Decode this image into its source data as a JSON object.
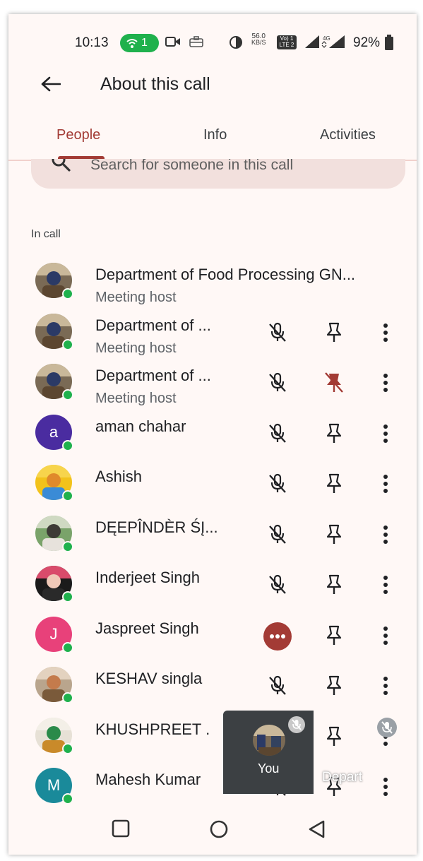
{
  "status": {
    "time": "10:13",
    "hotspot_count": "1",
    "speed_value": "56.0",
    "speed_unit": "KB/S",
    "volte_top": "Vo) 1",
    "volte_bottom": "LTE 2",
    "network": "4G",
    "battery": "92%",
    "icons": [
      "hotspot-icon",
      "video-camera-icon",
      "briefcase-icon",
      "vpn-icon",
      "signal-icon",
      "battery-icon"
    ]
  },
  "appbar": {
    "title": "About this call",
    "back_icon": "arrow-left-icon"
  },
  "tabs": [
    {
      "label": "People",
      "active": true
    },
    {
      "label": "Info",
      "active": false
    },
    {
      "label": "Activities",
      "active": false
    }
  ],
  "search": {
    "placeholder": "Search for someone in this call"
  },
  "section_label": "In call",
  "participants": [
    {
      "name": "Department of Food Processing GN...",
      "subtitle": "Meeting host",
      "avatar": "photo",
      "controls": false
    },
    {
      "name": "Department of ...",
      "subtitle": "Meeting host",
      "avatar": "photo",
      "controls": true,
      "pin_active": false
    },
    {
      "name": "Department of ...",
      "subtitle": "Meeting host",
      "avatar": "photo",
      "controls": true,
      "pin_active": true
    },
    {
      "name": "aman chahar",
      "subtitle": "",
      "avatar_letter": "a",
      "avatar_color": "#4a2ca0",
      "controls": true
    },
    {
      "name": "Ashish",
      "subtitle": "",
      "avatar": "photo",
      "controls": true
    },
    {
      "name": "DĘEPÎNDÈR ŚĮ...",
      "subtitle": "",
      "avatar": "photo",
      "controls": true
    },
    {
      "name": "Inderjeet Singh",
      "subtitle": "",
      "avatar": "photo",
      "controls": true
    },
    {
      "name": "Jaspreet Singh",
      "subtitle": "",
      "avatar_letter": "J",
      "avatar_color": "#e8417a",
      "controls": true,
      "mic_state": "more"
    },
    {
      "name": "KESHAV singla",
      "subtitle": "",
      "avatar": "photo",
      "controls": true
    },
    {
      "name": "KHUSHPREET .",
      "subtitle": "",
      "avatar": "photo",
      "controls": true
    },
    {
      "name": "Mahesh Kumar",
      "subtitle": "",
      "avatar_letter": "M",
      "avatar_color": "#1a8a9a",
      "controls": true
    }
  ],
  "self_tile": {
    "label": "You"
  },
  "ghost_text": "Depart",
  "colors": {
    "accent": "#a33b35",
    "online": "#1fb14d",
    "background": "#fff8f6"
  }
}
